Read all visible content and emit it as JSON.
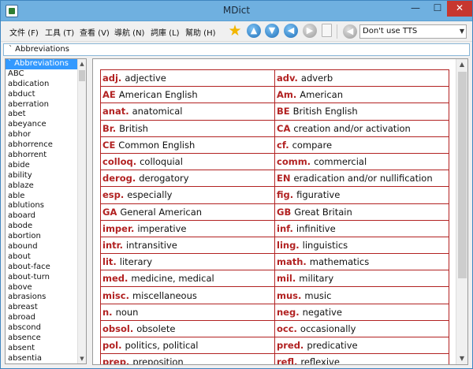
{
  "window": {
    "title": "MDict",
    "min_glyph": "—",
    "max_glyph": "☐",
    "close_glyph": "✕"
  },
  "menu": [
    {
      "label": "文件 (F)"
    },
    {
      "label": "工具 (T)"
    },
    {
      "label": "查看 (V)"
    },
    {
      "label": "導航 (N)"
    },
    {
      "label": "詞庫 (L)"
    },
    {
      "label": "幫助 (H)"
    }
  ],
  "toolbar": {
    "star_glyph": "★",
    "up_glyph": "▲",
    "down_glyph": "▼",
    "back_glyph": "◀",
    "forward_glyph": "▶",
    "tts_icon_glyph": "◀",
    "tts_value": "Don't use TTS",
    "tts_arrow": "▼"
  },
  "search": {
    "value": "` Abbreviations"
  },
  "wordlist": {
    "items": [
      "` Abbreviations",
      "ABC",
      "abdication",
      "abduct",
      "aberration",
      "abet",
      "abeyance",
      "abhor",
      "abhorrence",
      "abhorrent",
      "abide",
      "ability",
      "ablaze",
      "able",
      "ablutions",
      "aboard",
      "abode",
      "abortion",
      "abound",
      "about",
      "about-face",
      "about-turn",
      "above",
      "abrasions",
      "abreast",
      "abroad",
      "abscond",
      "absence",
      "absent",
      "absentia"
    ],
    "selected_index": 0,
    "scroll_up": "▲",
    "scroll_down": "▼"
  },
  "content": {
    "scroll_up": "▲",
    "scroll_down": "▼",
    "rows": [
      [
        {
          "k": "adj.",
          "v": "adjective"
        },
        {
          "k": "adv.",
          "v": "adverb"
        }
      ],
      [
        {
          "k": "AE",
          "v": "American English"
        },
        {
          "k": "Am.",
          "v": "American"
        }
      ],
      [
        {
          "k": "anat.",
          "v": "anatomical"
        },
        {
          "k": "BE",
          "v": "British English"
        }
      ],
      [
        {
          "k": "Br.",
          "v": "British"
        },
        {
          "k": "CA",
          "v": "creation and/or activation"
        }
      ],
      [
        {
          "k": "CE",
          "v": "Common English"
        },
        {
          "k": "cf.",
          "v": "compare"
        }
      ],
      [
        {
          "k": "colloq.",
          "v": "colloquial"
        },
        {
          "k": "comm.",
          "v": "commercial"
        }
      ],
      [
        {
          "k": "derog.",
          "v": "derogatory"
        },
        {
          "k": "EN",
          "v": "eradication and/or nullification"
        }
      ],
      [
        {
          "k": "esp.",
          "v": "especially"
        },
        {
          "k": "fig.",
          "v": "figurative"
        }
      ],
      [
        {
          "k": "GA",
          "v": "General American"
        },
        {
          "k": "GB",
          "v": "Great Britain"
        }
      ],
      [
        {
          "k": "imper.",
          "v": "imperative"
        },
        {
          "k": "inf.",
          "v": "infinitive"
        }
      ],
      [
        {
          "k": "intr.",
          "v": "intransitive"
        },
        {
          "k": "ling.",
          "v": "linguistics"
        }
      ],
      [
        {
          "k": "lit.",
          "v": "literary"
        },
        {
          "k": "math.",
          "v": "mathematics"
        }
      ],
      [
        {
          "k": "med.",
          "v": "medicine, medical"
        },
        {
          "k": "mil.",
          "v": "military"
        }
      ],
      [
        {
          "k": "misc.",
          "v": "miscellaneous"
        },
        {
          "k": "mus.",
          "v": "music"
        }
      ],
      [
        {
          "k": "n.",
          "v": "noun"
        },
        {
          "k": "neg.",
          "v": "negative"
        }
      ],
      [
        {
          "k": "obsol.",
          "v": "obsolete"
        },
        {
          "k": "occ.",
          "v": "occasionally"
        }
      ],
      [
        {
          "k": "pol.",
          "v": "politics, political"
        },
        {
          "k": "pred.",
          "v": "predicative"
        }
      ],
      [
        {
          "k": "prep.",
          "v": "preposition"
        },
        {
          "k": "refl.",
          "v": "reflexive"
        }
      ]
    ]
  }
}
